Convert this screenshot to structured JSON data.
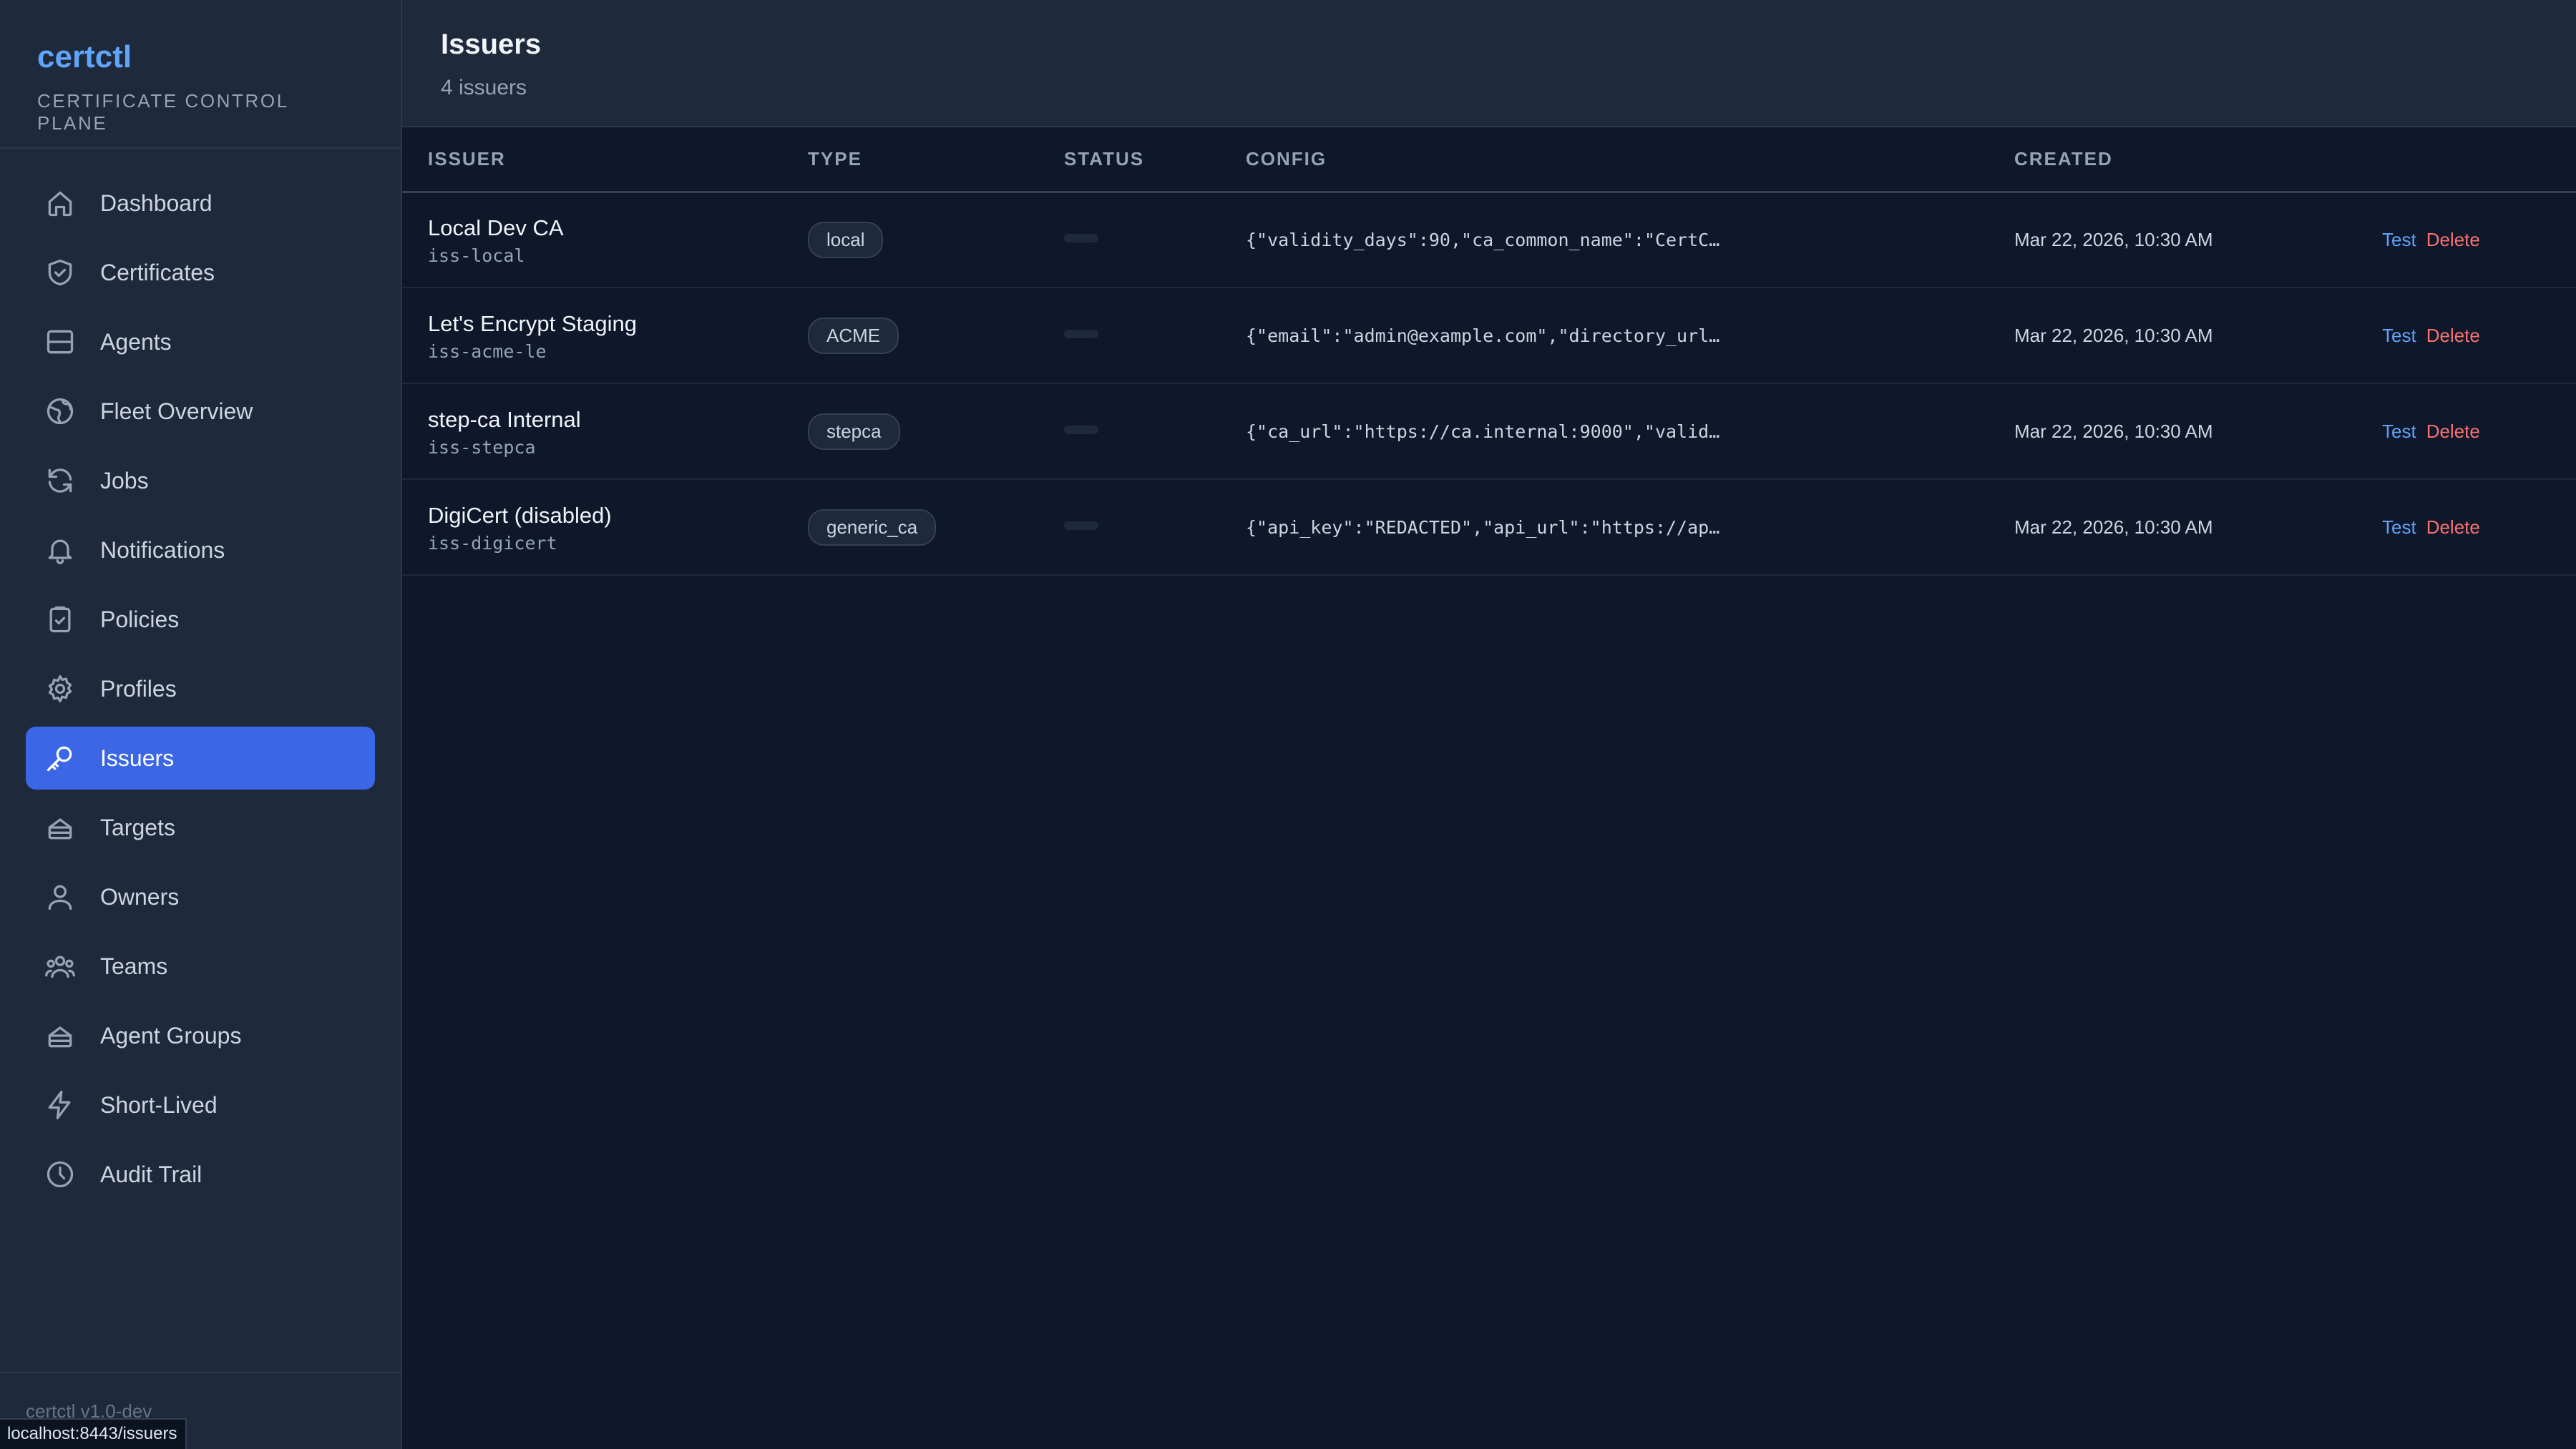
{
  "brand": {
    "name": "certctl",
    "subtitle": "CERTIFICATE CONTROL PLANE"
  },
  "nav": [
    {
      "label": "Dashboard",
      "icon": "home-icon"
    },
    {
      "label": "Certificates",
      "icon": "shield-icon"
    },
    {
      "label": "Agents",
      "icon": "server-icon"
    },
    {
      "label": "Fleet Overview",
      "icon": "globe-icon"
    },
    {
      "label": "Jobs",
      "icon": "refresh-icon"
    },
    {
      "label": "Notifications",
      "icon": "bell-icon"
    },
    {
      "label": "Policies",
      "icon": "clipboard-check-icon"
    },
    {
      "label": "Profiles",
      "icon": "gear-icon"
    },
    {
      "label": "Issuers",
      "icon": "key-icon",
      "active": true
    },
    {
      "label": "Targets",
      "icon": "stack-icon"
    },
    {
      "label": "Owners",
      "icon": "user-icon"
    },
    {
      "label": "Teams",
      "icon": "users-icon"
    },
    {
      "label": "Agent Groups",
      "icon": "stack-icon"
    },
    {
      "label": "Short-Lived",
      "icon": "bolt-icon"
    },
    {
      "label": "Audit Trail",
      "icon": "clock-icon"
    }
  ],
  "footer": {
    "version": "certctl v1.0-dev"
  },
  "status_url": "localhost:8443/issuers",
  "header": {
    "title": "Issuers",
    "subtitle": "4 issuers"
  },
  "table": {
    "columns": [
      "ISSUER",
      "TYPE",
      "STATUS",
      "CONFIG",
      "CREATED",
      ""
    ],
    "rows": [
      {
        "name": "Local Dev CA",
        "id": "iss-local",
        "type": "local",
        "config": "{\"validity_days\":90,\"ca_common_name\":\"CertC…",
        "created": "Mar 22, 2026, 10:30 AM"
      },
      {
        "name": "Let's Encrypt Staging",
        "id": "iss-acme-le",
        "type": "ACME",
        "config": "{\"email\":\"admin@example.com\",\"directory_url…",
        "created": "Mar 22, 2026, 10:30 AM"
      },
      {
        "name": "step-ca Internal",
        "id": "iss-stepca",
        "type": "stepca",
        "config": "{\"ca_url\":\"https://ca.internal:9000\",\"valid…",
        "created": "Mar 22, 2026, 10:30 AM"
      },
      {
        "name": "DigiCert (disabled)",
        "id": "iss-digicert",
        "type": "generic_ca",
        "config": "{\"api_key\":\"REDACTED\",\"api_url\":\"https://ap…",
        "created": "Mar 22, 2026, 10:30 AM"
      }
    ],
    "actions": {
      "test": "Test",
      "delete": "Delete"
    }
  },
  "colors": {
    "accent": "#3b66e6",
    "link": "#60a5fa",
    "danger": "#f87171",
    "bg": "#0f172a",
    "panel": "#1e293b"
  }
}
